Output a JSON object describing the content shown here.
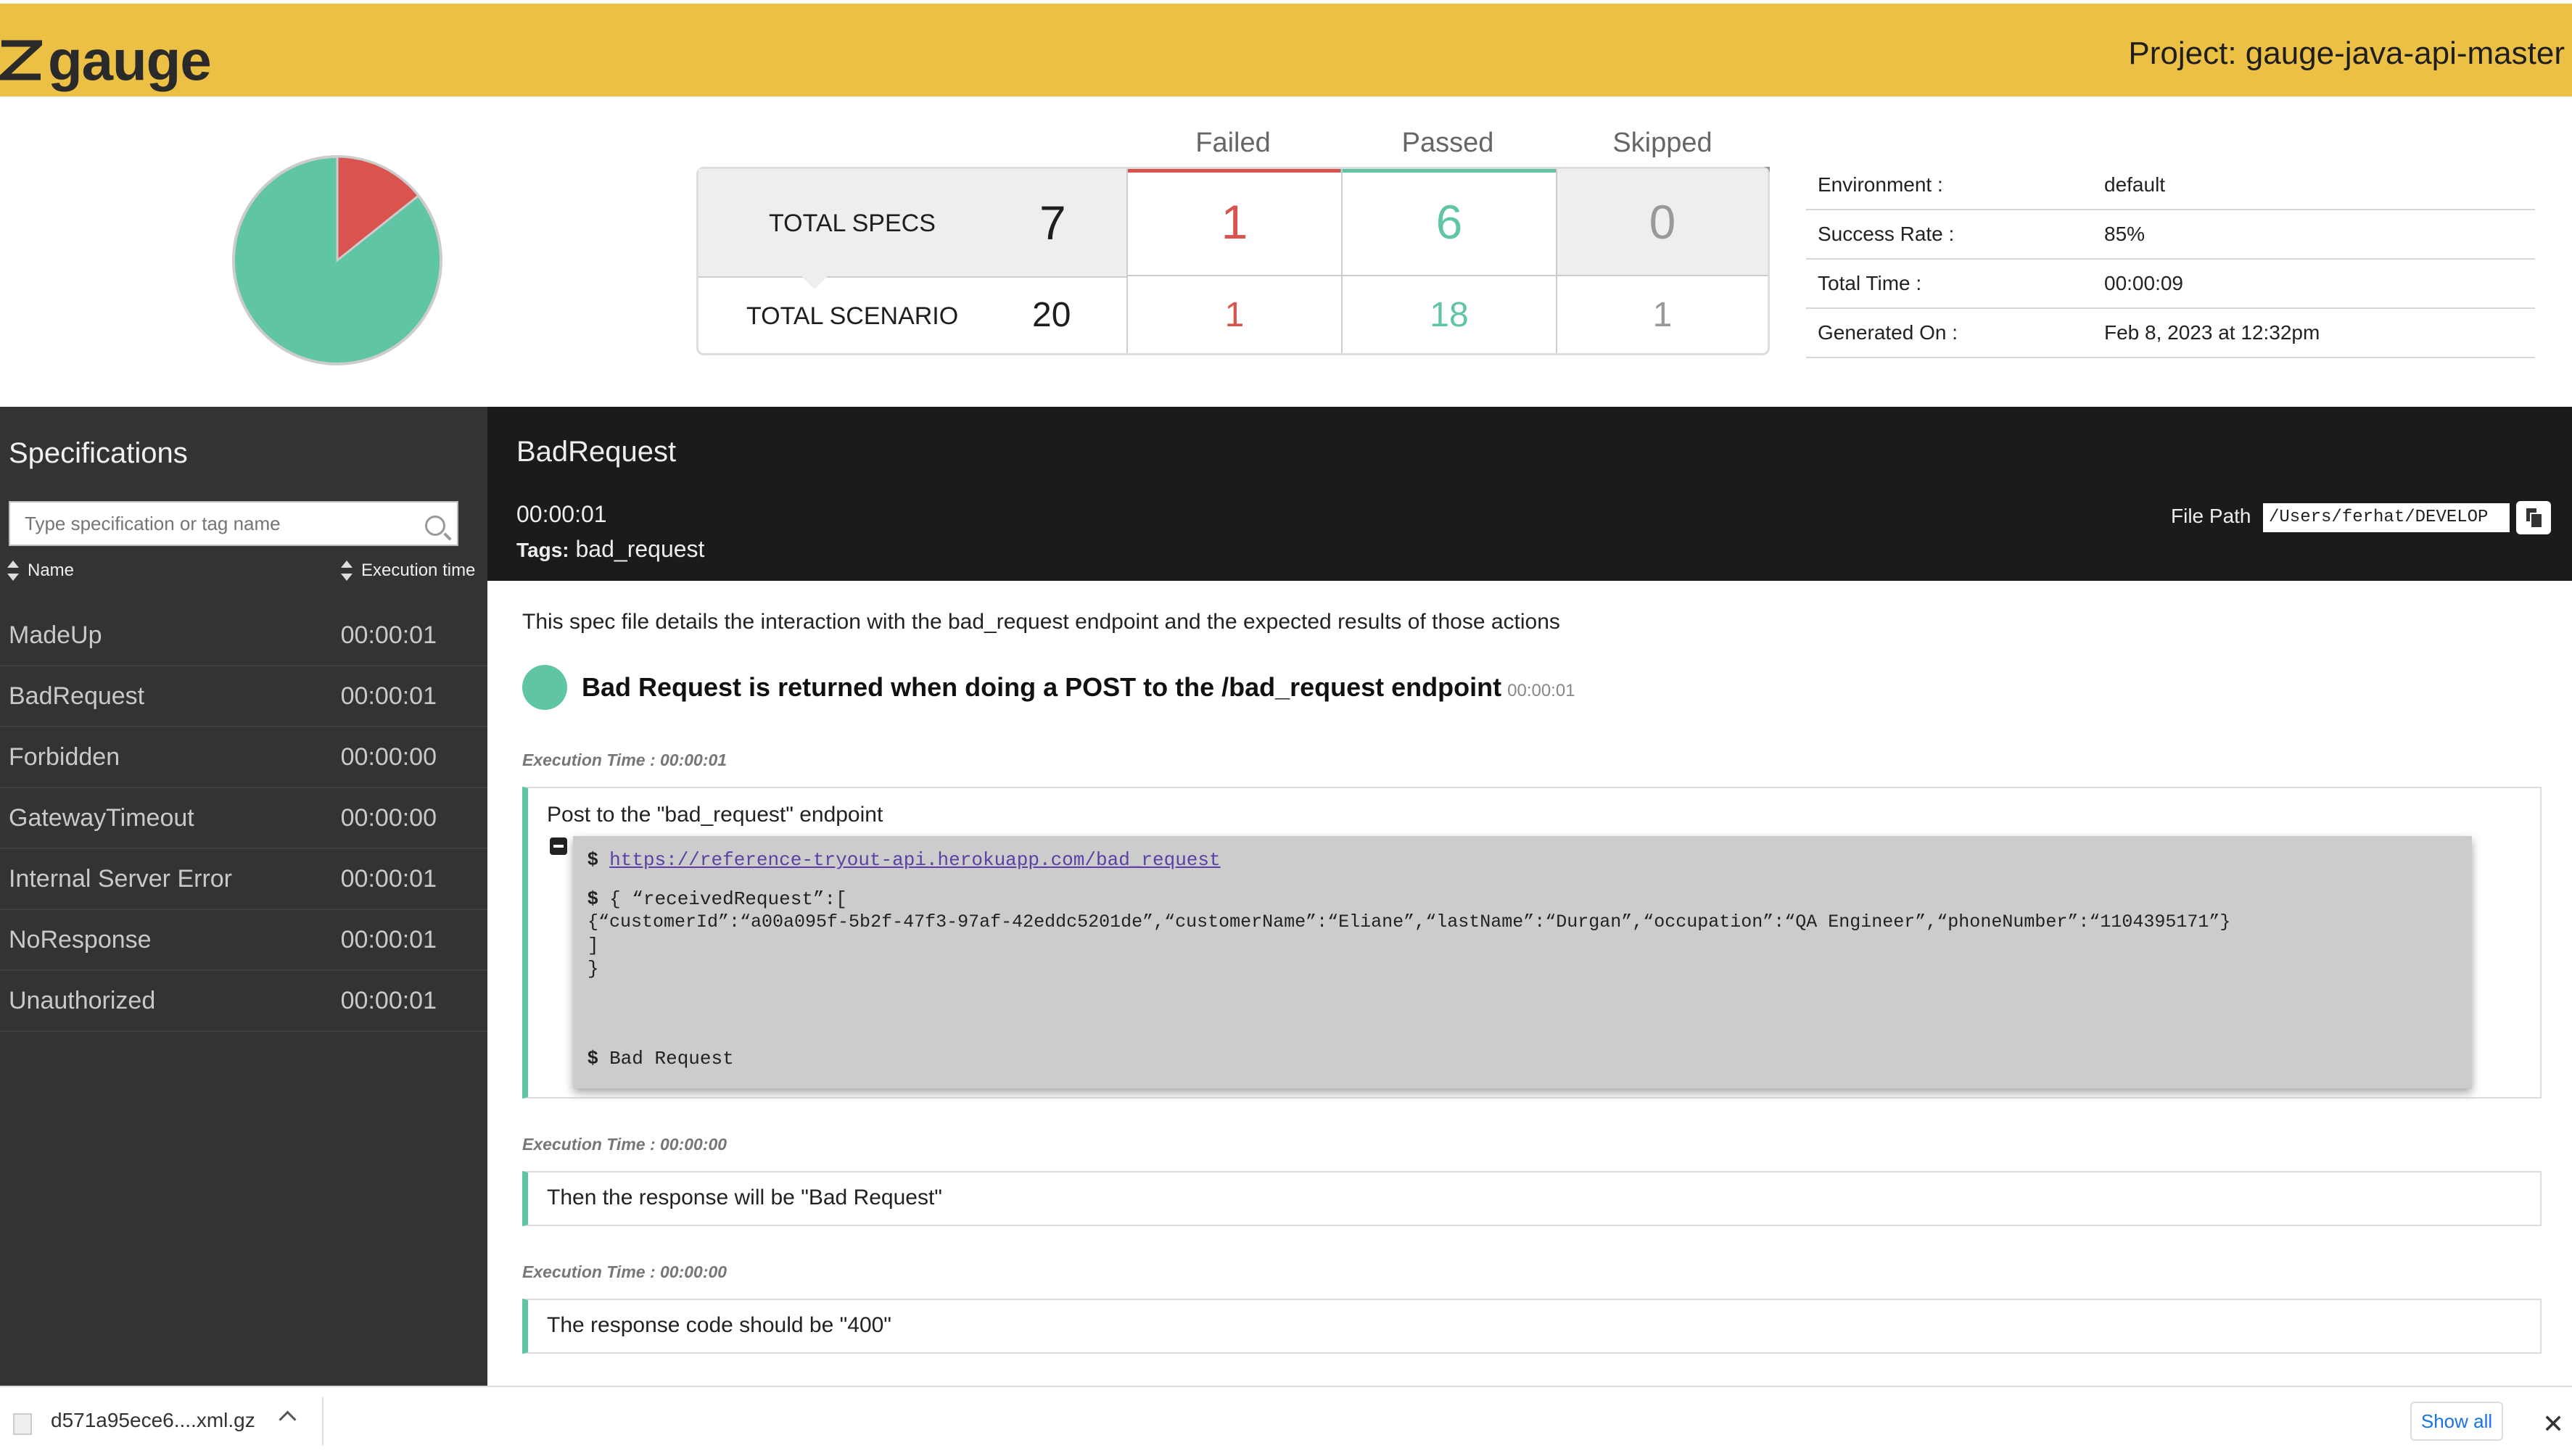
{
  "header": {
    "logo_text": "gauge",
    "project": "Project: gauge-java-api-master",
    "bg": "#ecc045"
  },
  "summary": {
    "pie": {
      "passed_fraction": 0.857,
      "failed_fraction": 0.143,
      "passed_color": "#5fc5a4",
      "failed_color": "#d9534f"
    },
    "columns": {
      "failed": "Failed",
      "passed": "Passed",
      "skipped": "Skipped"
    },
    "specs": {
      "label": "TOTAL SPECS",
      "total": "7",
      "failed": "1",
      "passed": "6",
      "skipped": "0"
    },
    "scenarios": {
      "label": "TOTAL SCENARIO",
      "total": "20",
      "failed": "1",
      "passed": "18",
      "skipped": "1"
    }
  },
  "env": [
    {
      "key": "Environment :",
      "value": "default"
    },
    {
      "key": "Success Rate :",
      "value": "85%"
    },
    {
      "key": "Total Time :",
      "value": "00:00:09"
    },
    {
      "key": "Generated On :",
      "value": "Feb 8, 2023 at 12:32pm"
    }
  ],
  "sidebar": {
    "title": "Specifications",
    "search_placeholder": "Type specification or tag name",
    "col_name": "Name",
    "col_time": "Execution time",
    "items": [
      {
        "name": "MadeUp",
        "time": "00:00:01"
      },
      {
        "name": "BadRequest",
        "time": "00:00:01"
      },
      {
        "name": "Forbidden",
        "time": "00:00:00"
      },
      {
        "name": "GatewayTimeout",
        "time": "00:00:00"
      },
      {
        "name": "Internal Server Error",
        "time": "00:00:01"
      },
      {
        "name": "NoResponse",
        "time": "00:00:01"
      },
      {
        "name": "Unauthorized",
        "time": "00:00:01"
      }
    ]
  },
  "spec": {
    "title": "BadRequest",
    "time": "00:00:01",
    "tags_label": "Tags:",
    "tags": "bad_request",
    "file_path_label": "File Path",
    "file_path": "/Users/ferhat/DEVELOP",
    "description": "This spec file details the interaction with the bad_request endpoint and the expected results of those actions",
    "scenario": {
      "name": "Bad Request is returned when doing a POST to the /bad_request endpoint",
      "time": "00:00:01"
    },
    "steps": [
      {
        "exec_time": "Execution Time : 00:00:01",
        "text": "Post to the \"bad_request\" endpoint",
        "messages": {
          "prompt": "$",
          "url": "https://reference-tryout-api.herokuapp.com/bad_request",
          "body_line1": "{ “receivedRequest”:[",
          "body_line2": "{“customerId”:“a00a095f-5b2f-47f3-97af-42eddc5201de”,“customerName”:“Eliane”,“lastName”:“Durgan”,“occupation”:“QA Engineer”,“phoneNumber”:“1104395171”}",
          "body_line3": "]",
          "body_line4": "}",
          "result": "Bad Request"
        }
      },
      {
        "exec_time": "Execution Time : 00:00:00",
        "text": "Then the response will be \"Bad Request\""
      },
      {
        "exec_time": "Execution Time : 00:00:00",
        "text": "The response code should be \"400\""
      }
    ]
  },
  "download_bar": {
    "file": "d571a95ece6....xml.gz",
    "show_all": "Show all",
    "close": "✕"
  }
}
